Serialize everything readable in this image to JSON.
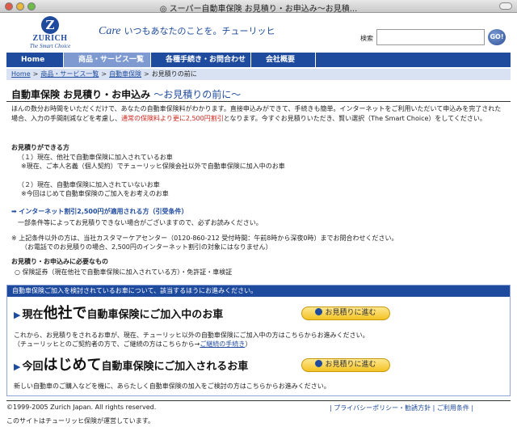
{
  "window": {
    "title": "◎ スーパー自動車保険 お見積り・お申込み〜お見積..."
  },
  "header": {
    "logo_mark": "Z",
    "logo_name": "ZURICH",
    "logo_tagline": "The Smart Choice",
    "tagline_care": "Care",
    "tagline_text": "いつもあなたのことを。チューリッヒ",
    "search_label": "検索",
    "search_value": "",
    "go_label": "GO!"
  },
  "nav": {
    "items": [
      {
        "label": "Home"
      },
      {
        "label": "商品・サービス一覧"
      },
      {
        "label": "各種手続き・お問合わせ"
      },
      {
        "label": "会社概要"
      }
    ]
  },
  "breadcrumb": {
    "items": [
      "Home",
      "商品・サービス一覧",
      "自動車保険",
      "お見積りの前に"
    ]
  },
  "page": {
    "title": "自動車保険 お見積り・お申込み",
    "title_sub": "〜お見積りの前に〜",
    "intro_1": "ほんの数分お時間をいただくだけで、あなたの自動車保険料がわかります。直接申込みができて、手続きも簡単。インターネットをご利用いただいて申込みを完了された場合、入力の手間削減などを考慮し、",
    "intro_red": "通常の保険料より更に2,500円割引",
    "intro_2": "となります。今すぐお見積りいただき、賢い選択（The Smart Choice）をしてください。"
  },
  "section1": {
    "heading": "お見積りができる方",
    "item1": "（１）現在、他社で自動車保険に加入されているお車",
    "item1_note": "※現在、ご本人名義（個人契約）でチューリッヒ保険会社以外で自動車保険に加入中のお車",
    "item2": "（２）現在、自動車保険に加入されていないお車",
    "item2_note": "※今回はじめて自動車保険のご加入をお考えのお車"
  },
  "section2": {
    "link": "インターネット割引2,500円が適用される方（引受条件）",
    "note": "一部条件等によってお見積りできない場合がございますので、必ずお読みください。",
    "cond_1": "※ 上記条件以外の方は、当社カスタマーケアセンター（0120-860-212 受付時間：午前8時から深夜0時）までお問合わせください。",
    "cond_2": "（お電話でのお見積りの場合、2,500円のインターネット割引の対象にはなりません）"
  },
  "section3": {
    "heading": "お見積り・お申込みに必要なもの",
    "item": "○ 保険証券（現在他社で自動車保険に加入されている方）・免許証・車検証"
  },
  "cta": {
    "head": "自動車保険ご加入を検討されているお車について、該当するほうにお進みください。",
    "row1_pre": "現在",
    "row1_big": "他社で",
    "row1_post": "自動車保険にご加入中のお車",
    "row1_btn": "お見積りに進む",
    "row1_text_1": "これから、お見積りをされるお車が、現在、チューリッヒ以外の自動車保険にご加入中の方はこちらからお進みください。",
    "row1_text_2": "（チューリッヒとのご契約者の方で、ご継続の方はこちらから→",
    "row1_link": "ご継続の手続き",
    "row1_text_3": "）",
    "row2_pre": "今回",
    "row2_big": "はじめて",
    "row2_post": "自動車保険にご加入されるお車",
    "row2_btn": "お見積りに進む",
    "row2_text": "新しい自動車のご購入などを機に、あらたしく自動車保険の加入をご検討の方はこちらからお進みください。"
  },
  "footer": {
    "copyright": "©1999-2005 Zurich Japan. All rights reserved.",
    "operator": "このサイトはチューリッヒ保険が運営しています。",
    "link_privacy": "| プライバシーポリシー・勧誘方針 | ご利用条件 |"
  }
}
